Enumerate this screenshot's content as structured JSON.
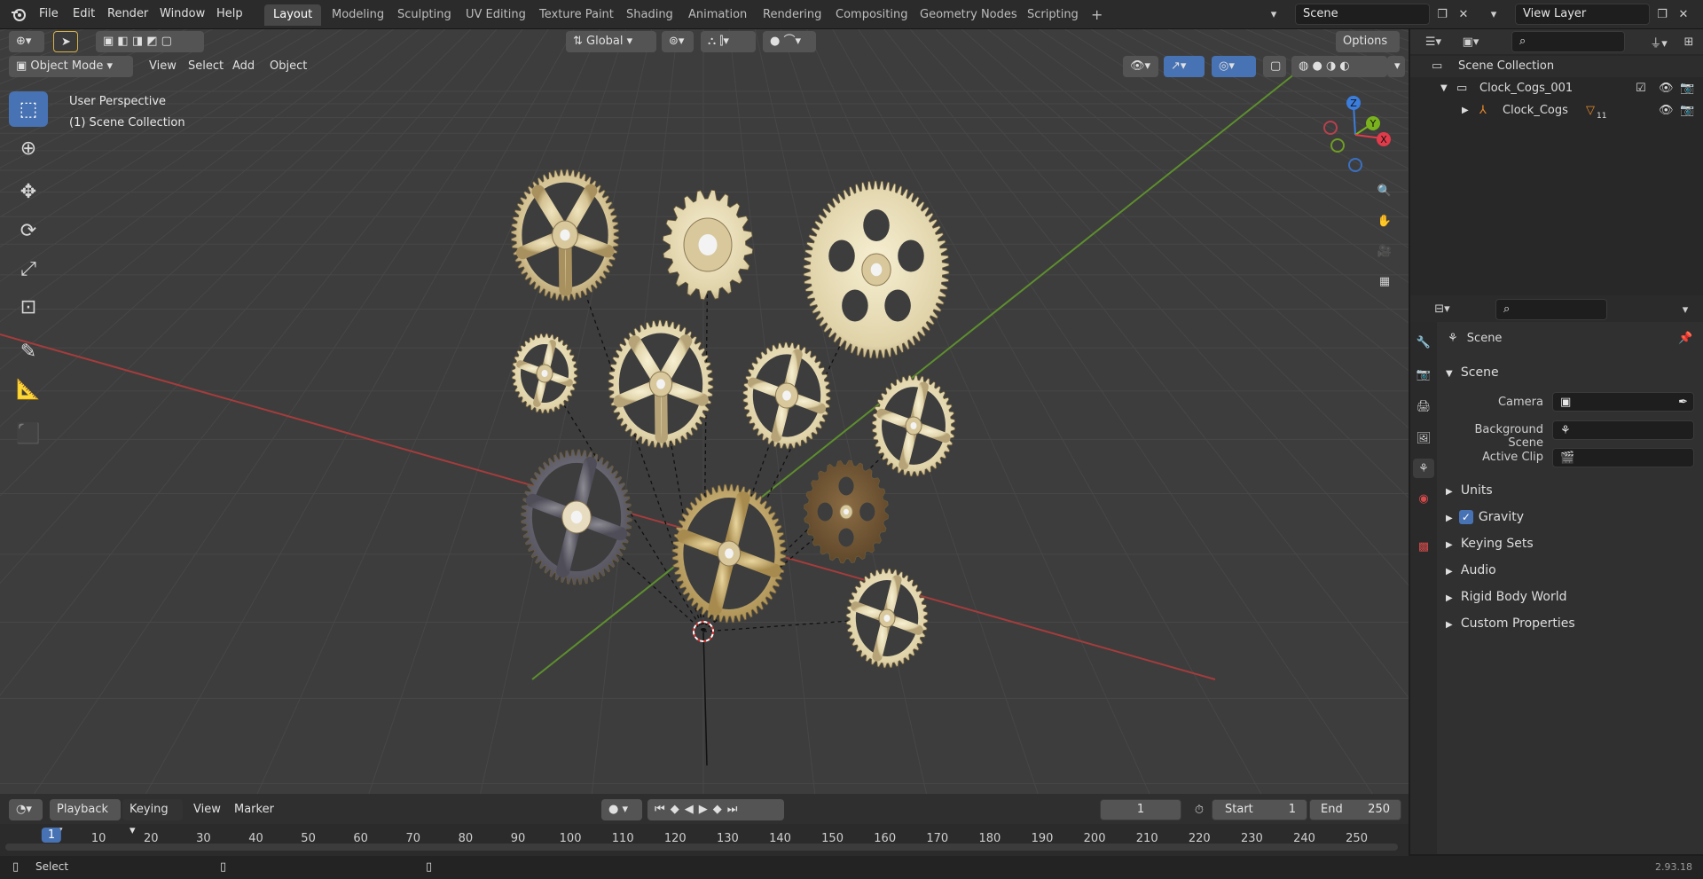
{
  "menu": [
    "File",
    "Edit",
    "Render",
    "Window",
    "Help"
  ],
  "workspaces": [
    "Layout",
    "Modeling",
    "Sculpting",
    "UV Editing",
    "Texture Paint",
    "Shading",
    "Animation",
    "Rendering",
    "Compositing",
    "Geometry Nodes",
    "Scripting"
  ],
  "workspace_add": "+",
  "scene_field": "Scene",
  "view_layer_field": "View Layer",
  "viewport": {
    "mode": "Object Mode",
    "menus": [
      "View",
      "Select",
      "Add",
      "Object"
    ],
    "orientation": "Global",
    "options": "Options",
    "overlay_title": "User Perspective",
    "overlay_subtitle": "(1) Scene Collection",
    "gizmo": {
      "x": "X",
      "y": "Y",
      "z": "Z"
    }
  },
  "outliner": {
    "root": "Scene Collection",
    "collection": "Clock_Cogs_001",
    "object": "Clock_Cogs",
    "object_badge": "11"
  },
  "properties": {
    "header": "Scene",
    "panel": "Scene",
    "camera_label": "Camera",
    "background_scene_label": "Background Scene",
    "active_clip_label": "Active Clip",
    "sections": [
      "Units",
      "Gravity",
      "Keying Sets",
      "Audio",
      "Rigid Body World",
      "Custom Properties"
    ],
    "gravity_checked": true
  },
  "timeline": {
    "menus": [
      "Playback",
      "Keying",
      "View",
      "Marker"
    ],
    "current_frame": "1",
    "start_label": "Start",
    "start_value": "1",
    "end_label": "End",
    "end_value": "250",
    "ticks": [
      "1",
      "10",
      "20",
      "30",
      "40",
      "50",
      "60",
      "70",
      "80",
      "90",
      "100",
      "110",
      "120",
      "130",
      "140",
      "150",
      "160",
      "170",
      "180",
      "190",
      "200",
      "210",
      "220",
      "230",
      "240",
      "250"
    ]
  },
  "status": {
    "select": "Select",
    "version": "2.93.18"
  },
  "colors": {
    "accent": "#4772b3",
    "viewport_bg": "#3d3d3d",
    "x_axis": "#b33a3a",
    "y_axis": "#5a8f2a"
  }
}
